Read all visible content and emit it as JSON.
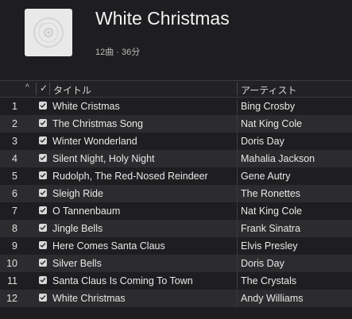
{
  "album": {
    "title": "White Christmas",
    "subtitle": "12曲 · 36分",
    "artwork_icon": "cd-icon"
  },
  "columns": {
    "sort_indicator": "^",
    "check": "✓",
    "title": "タイトル",
    "artist": "アーティスト"
  },
  "tracks": [
    {
      "num": "1",
      "title": "White Cristmas",
      "artist": "Bing Crosby",
      "checked": true
    },
    {
      "num": "2",
      "title": "The Christmas Song",
      "artist": "Nat King Cole",
      "checked": true
    },
    {
      "num": "3",
      "title": "Winter Wonderland",
      "artist": "Doris Day",
      "checked": true
    },
    {
      "num": "4",
      "title": "Silent Night, Holy Night",
      "artist": "Mahalia Jackson",
      "checked": true
    },
    {
      "num": "5",
      "title": "Rudolph, The Red-Nosed Reindeer",
      "artist": "Gene Autry",
      "checked": true
    },
    {
      "num": "6",
      "title": "Sleigh Ride",
      "artist": "The Ronettes",
      "checked": true
    },
    {
      "num": "7",
      "title": "O Tannenbaum",
      "artist": "Nat King Cole",
      "checked": true
    },
    {
      "num": "8",
      "title": "Jingle Bells",
      "artist": "Frank Sinatra",
      "checked": true
    },
    {
      "num": "9",
      "title": "Here Comes Santa Claus",
      "artist": "Elvis Presley",
      "checked": true
    },
    {
      "num": "10",
      "title": "Silver Bells",
      "artist": "Doris Day",
      "checked": true
    },
    {
      "num": "11",
      "title": "Santa Claus Is Coming To Town",
      "artist": "The Crystals",
      "checked": true
    },
    {
      "num": "12",
      "title": "White Christmas",
      "artist": "Andy Williams",
      "checked": true
    }
  ],
  "colors": {
    "background": "#1e1e20",
    "row_alt": "#2c2c2e",
    "text": "#e8e8e8"
  }
}
